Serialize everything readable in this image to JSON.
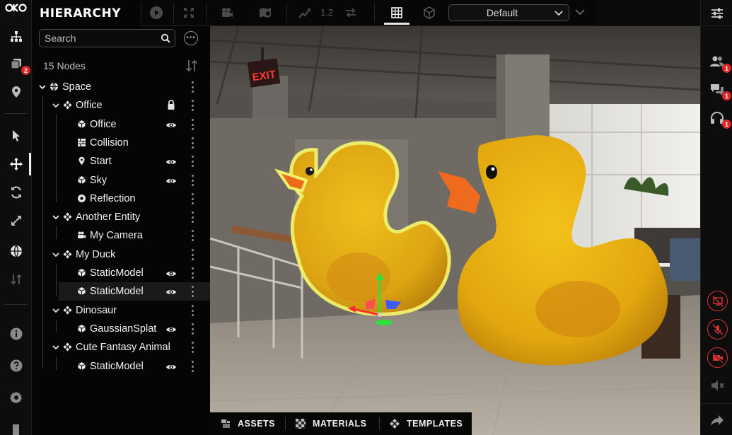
{
  "app": {
    "logo_text": "OKO",
    "accent": "#e8e8e8",
    "badge_color": "#e02424"
  },
  "left_rail": {
    "items": [
      {
        "icon": "hierarchy-icon"
      },
      {
        "icon": "layers-icon",
        "badge": "2"
      },
      {
        "icon": "location-pin-icon"
      },
      {
        "icon": "pointer-icon"
      },
      {
        "icon": "move-icon"
      },
      {
        "icon": "rotate-icon"
      },
      {
        "icon": "scale-icon"
      },
      {
        "icon": "globe-icon"
      },
      {
        "icon": "sort-icon"
      },
      {
        "icon": "info-icon"
      },
      {
        "icon": "help-icon"
      },
      {
        "icon": "settings-icon"
      },
      {
        "icon": "exit-icon"
      }
    ]
  },
  "hierarchy": {
    "title": "HIERARCHY",
    "search_placeholder": "Search",
    "node_count": "15 Nodes",
    "nodes": [
      {
        "label": "Space",
        "icon": "globe-icon",
        "depth": 0,
        "expanded": true
      },
      {
        "label": "Office",
        "icon": "entity-icon",
        "depth": 1,
        "expanded": true,
        "locked": true
      },
      {
        "label": "Office",
        "icon": "cube-icon",
        "depth": 2,
        "visible": true
      },
      {
        "label": "Collision",
        "icon": "collision-icon",
        "depth": 2
      },
      {
        "label": "Start",
        "icon": "location-pin-icon",
        "depth": 2,
        "visible": true
      },
      {
        "label": "Sky",
        "icon": "cube-icon",
        "depth": 2,
        "visible": true
      },
      {
        "label": "Reflection",
        "icon": "reflection-icon",
        "depth": 2
      },
      {
        "label": "Another Entity",
        "icon": "entity-icon",
        "depth": 1,
        "expanded": true
      },
      {
        "label": "My Camera",
        "icon": "camera-icon",
        "depth": 2
      },
      {
        "label": "My Duck",
        "icon": "entity-icon",
        "depth": 1,
        "expanded": true
      },
      {
        "label": "StaticModel",
        "icon": "cube-icon",
        "depth": 2,
        "visible": true
      },
      {
        "label": "StaticModel",
        "icon": "cube-icon",
        "depth": 2,
        "visible": true,
        "selected": true
      },
      {
        "label": "Dinosaur",
        "icon": "entity-icon",
        "depth": 1,
        "expanded": true
      },
      {
        "label": "GaussianSplat",
        "icon": "cube-icon",
        "depth": 2,
        "visible": true
      },
      {
        "label": "Cute Fantasy Animal",
        "icon": "entity-icon",
        "depth": 1,
        "expanded": true
      },
      {
        "label": "StaticModel",
        "icon": "cube-icon",
        "depth": 2,
        "visible": true
      }
    ]
  },
  "toolbar": {
    "zoom_value": "1.2",
    "view_mode": "Default",
    "buttons": [
      "play-icon",
      "expand-icon",
      "camera-icon",
      "map-pin-icon",
      "trend-icon",
      "swap-icon",
      "grid-icon",
      "cube-outline-icon"
    ]
  },
  "viewport": {
    "exit_sign_text": "EXIT"
  },
  "right_rail": {
    "items": [
      {
        "icon": "sliders-icon"
      },
      {
        "icon": "users-icon",
        "badge": "1"
      },
      {
        "icon": "chat-icon",
        "badge": "1"
      },
      {
        "icon": "headset-icon",
        "badge": "1"
      },
      {
        "icon": "screen-share-off-icon"
      },
      {
        "icon": "mic-off-icon"
      },
      {
        "icon": "video-off-icon"
      },
      {
        "icon": "speaker-muted-icon"
      },
      {
        "icon": "share-icon"
      }
    ]
  },
  "bottom_tabs": [
    {
      "label": "ASSETS",
      "icon": "assets-icon"
    },
    {
      "label": "MATERIALS",
      "icon": "materials-icon"
    },
    {
      "label": "TEMPLATES",
      "icon": "templates-icon"
    }
  ]
}
